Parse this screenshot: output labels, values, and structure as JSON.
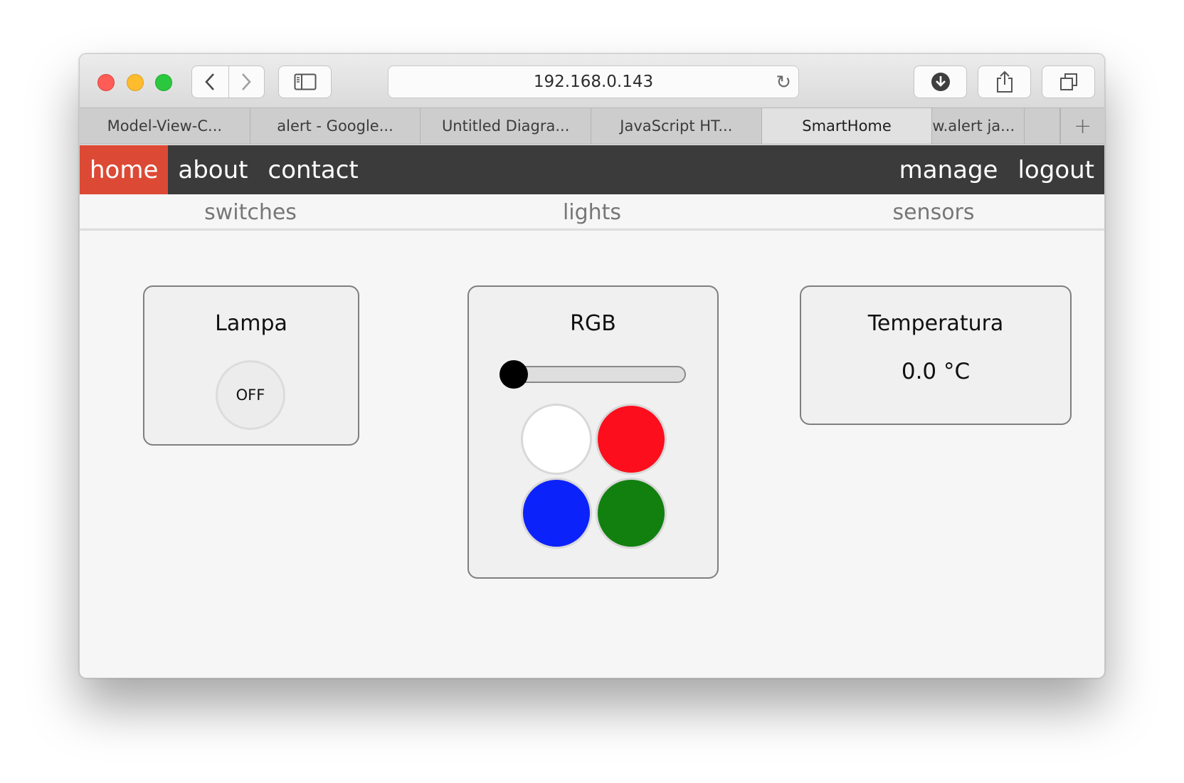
{
  "browser": {
    "url": "192.168.0.143",
    "tabs": [
      {
        "label": "Model-View-C...",
        "active": false
      },
      {
        "label": "alert - Google...",
        "active": false
      },
      {
        "label": "Untitled Diagra...",
        "active": false
      },
      {
        "label": "JavaScript HT...",
        "active": false
      },
      {
        "label": "SmartHome",
        "active": true
      },
      {
        "label": "w.alert ja...",
        "active": false
      }
    ],
    "new_tab_label": "+"
  },
  "nav": {
    "home": "home",
    "about": "about",
    "contact": "contact",
    "manage": "manage",
    "logout": "logout"
  },
  "subnav": {
    "switches": "switches",
    "lights": "lights",
    "sensors": "sensors"
  },
  "switches": {
    "title": "Lampa",
    "state": "OFF"
  },
  "lights": {
    "title": "RGB",
    "slider_value": 0,
    "colors": [
      {
        "name": "white",
        "hex": "#ffffff"
      },
      {
        "name": "red",
        "hex": "#fc0e1c"
      },
      {
        "name": "blue",
        "hex": "#0c22fb"
      },
      {
        "name": "green",
        "hex": "#11800f"
      }
    ]
  },
  "sensors": {
    "title": "Temperatura",
    "value": "0.0 °C"
  },
  "theme": {
    "nav_bg": "#3b3b3b",
    "active_accent": "#dc4a35"
  }
}
